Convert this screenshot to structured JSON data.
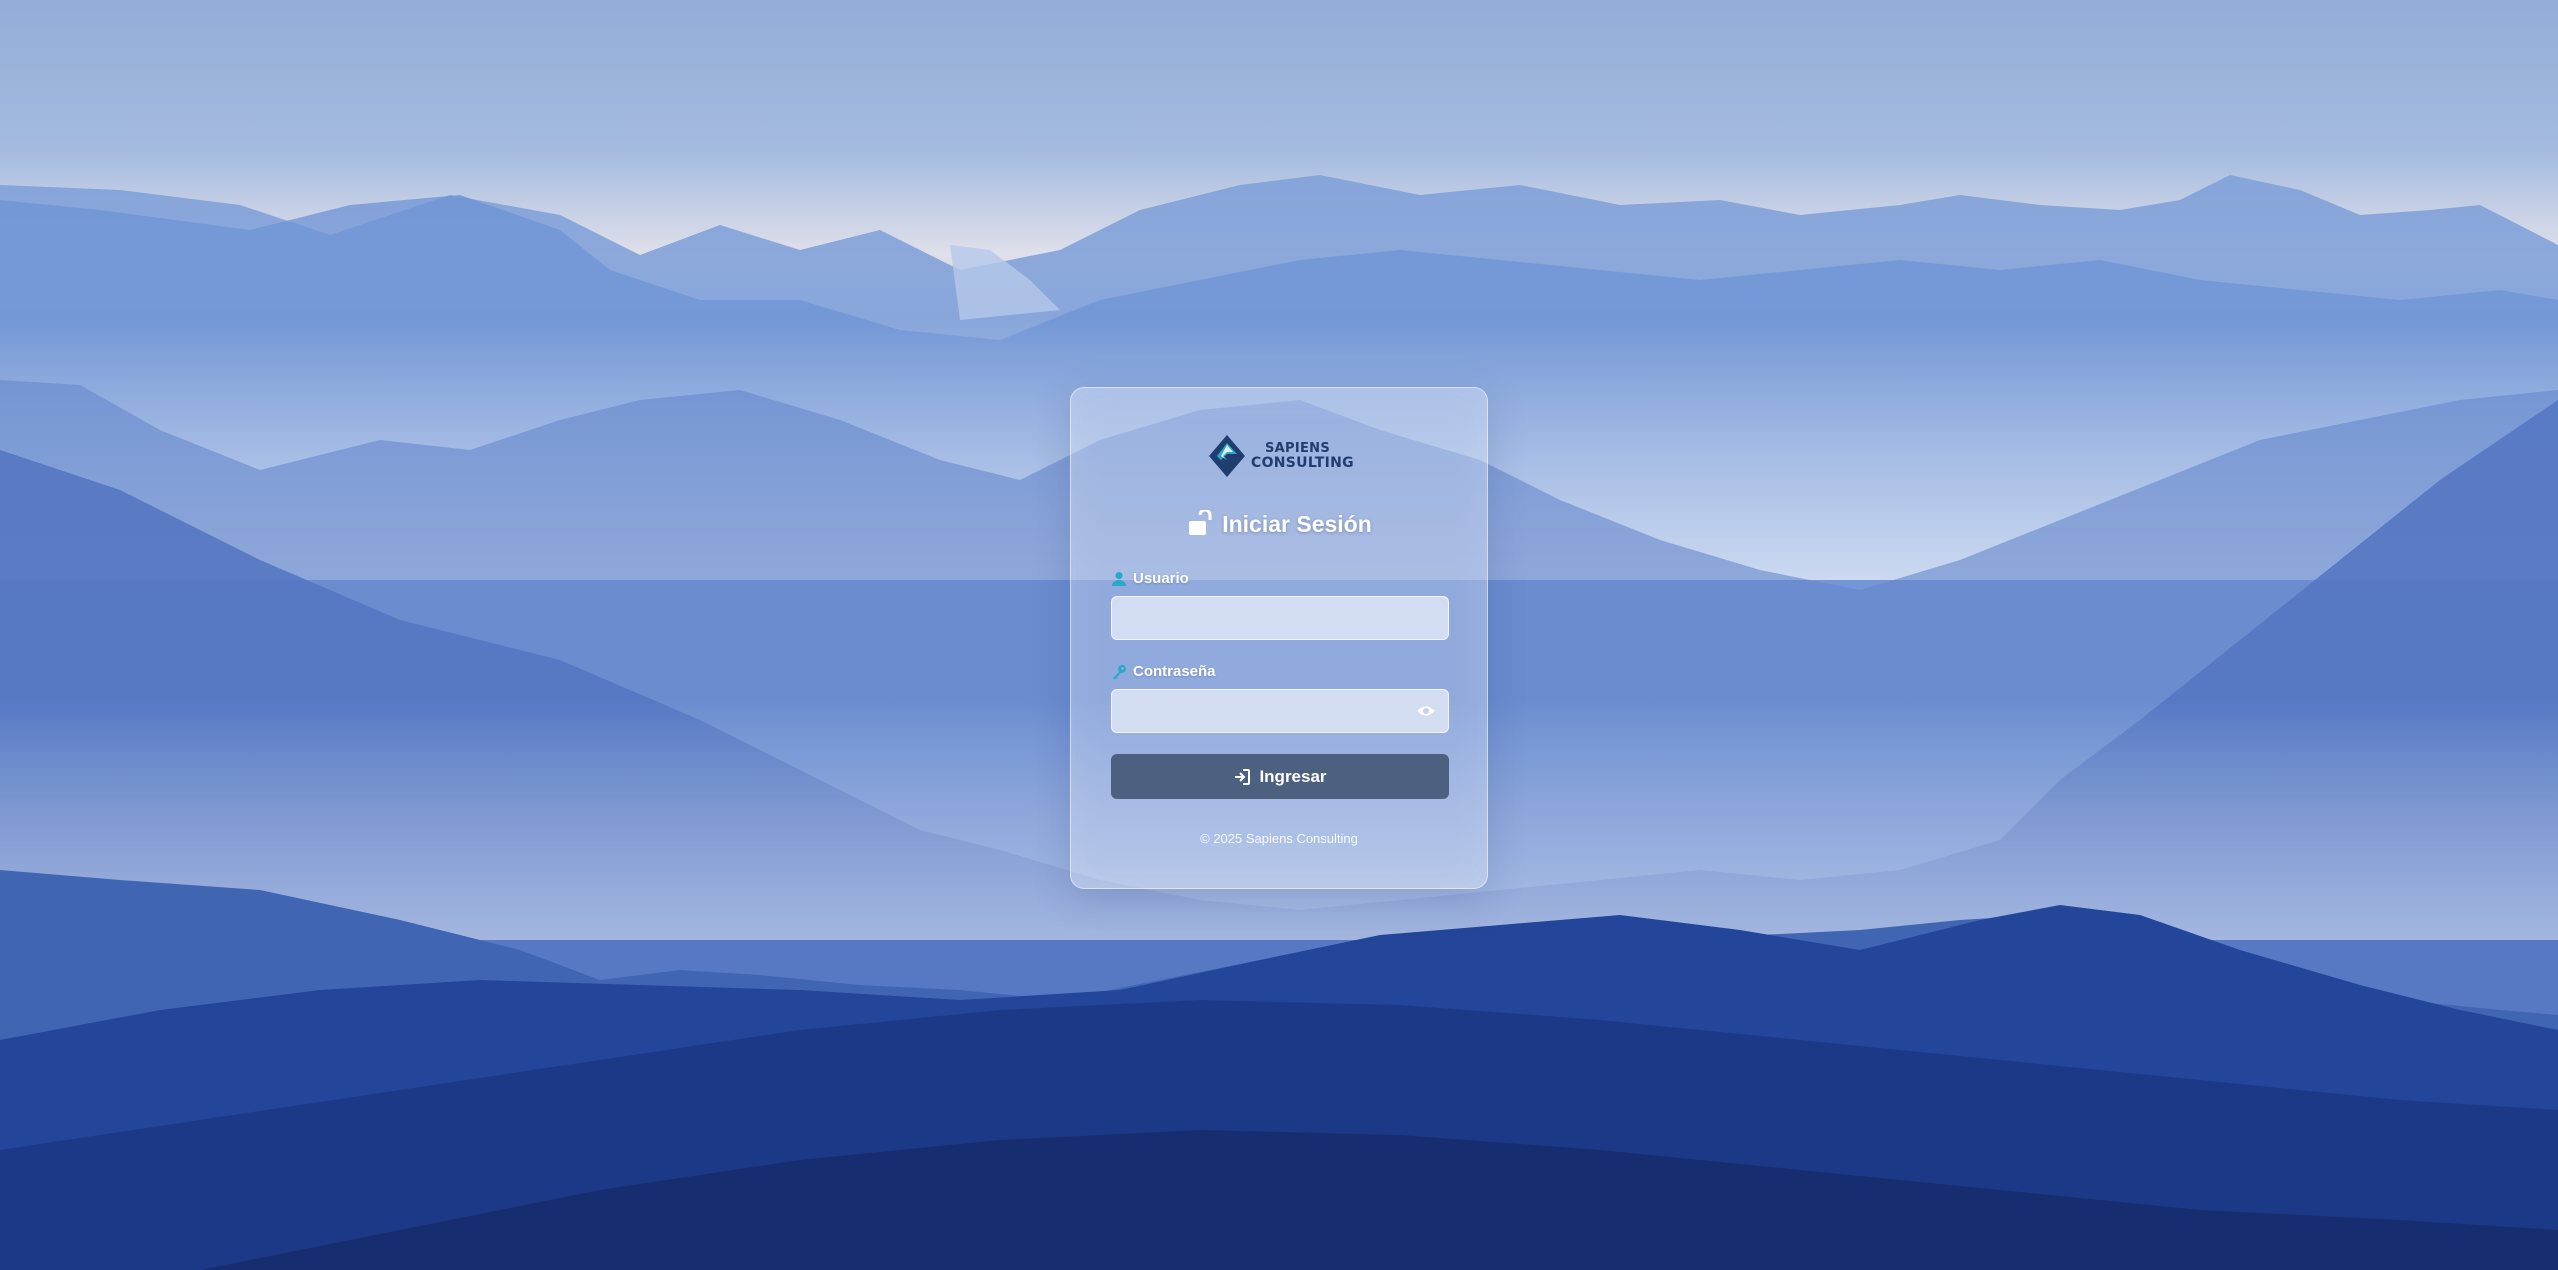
{
  "brand": {
    "logo_line1": "SAPIENS",
    "logo_line2": "CONSULTING",
    "colors": {
      "primary": "#1f3d6e",
      "accent": "#2aa7c9"
    }
  },
  "login": {
    "title": "Iniciar Sesión",
    "title_icon": "unlock-icon",
    "user_label": "Usuario",
    "user_icon": "user-icon",
    "user_value": "",
    "user_placeholder": "",
    "password_label": "Contraseña",
    "password_icon": "key-icon",
    "password_value": "",
    "password_placeholder": "",
    "toggle_icon": "eye-icon",
    "submit_label": "Ingresar",
    "submit_icon": "sign-in-icon",
    "button_color": "#4c607f"
  },
  "footer": {
    "copyright": "© 2025 Sapiens Consulting"
  }
}
